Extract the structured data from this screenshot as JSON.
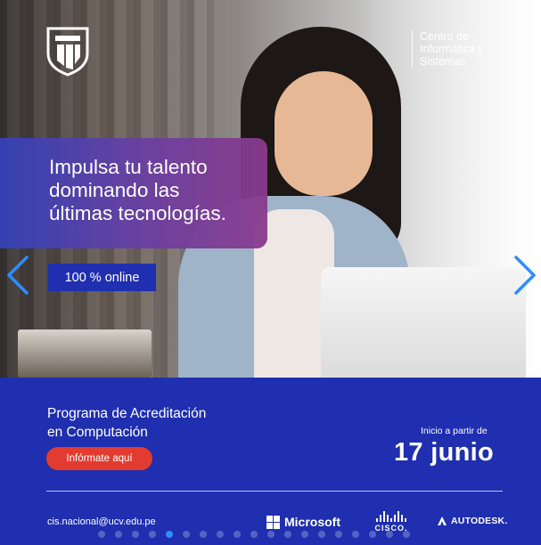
{
  "brand": {
    "center_name": "Centro de\nInformática y\nSistemas"
  },
  "hero": {
    "headline": "Impulsa tu talento\ndominando las\núltimas tecnologías.",
    "badge": "100 % online"
  },
  "carousel": {
    "prev_icon": "chevron-left-icon",
    "next_icon": "chevron-right-icon",
    "dot_count": 19,
    "active_dot": 4,
    "accent": "#2f8cff"
  },
  "program": {
    "title": "Programa de Acreditación\nen Computación",
    "cta_label": "Infórmate aquí",
    "start_label": "Inicio a partir de",
    "start_date": "17 junio"
  },
  "footer": {
    "email": "cis.nacional@ucv.edu.pe",
    "partners": {
      "microsoft": "Microsoft",
      "cisco": "CISCO.",
      "autodesk": "AUTODESK."
    }
  },
  "colors": {
    "panel": "#1f2fb0",
    "cta": "#e23b2f",
    "headline_gradient_start": "#3442b8",
    "headline_gradient_end": "#8a3a8c"
  }
}
